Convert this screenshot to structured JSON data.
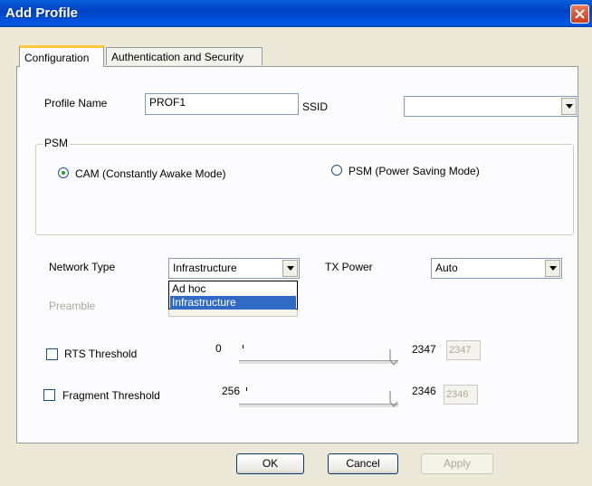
{
  "window": {
    "title": "Add Profile"
  },
  "tabs": [
    {
      "label": "Configuration",
      "active": true
    },
    {
      "label": "Authentication and Security",
      "active": false
    }
  ],
  "profile": {
    "name_label": "Profile Name",
    "name_value": "PROF1",
    "ssid_label": "SSID",
    "ssid_value": ""
  },
  "psm": {
    "group_label": "PSM",
    "cam_label": "CAM (Constantly Awake Mode)",
    "cam_selected": true,
    "psm_label": "PSM (Power Saving Mode)",
    "psm_selected": false
  },
  "network_type": {
    "label": "Network Type",
    "value": "Infrastructure",
    "options": [
      "Ad hoc",
      "Infrastructure"
    ],
    "highlighted": "Infrastructure"
  },
  "tx_power": {
    "label": "TX Power",
    "value": "Auto"
  },
  "preamble": {
    "label": "Preamble"
  },
  "rts": {
    "label": "RTS Threshold",
    "checked": false,
    "min": "0",
    "max": "2347",
    "value": "2347"
  },
  "fragment": {
    "label": "Fragment Threshold",
    "checked": false,
    "min": "256",
    "max": "2346",
    "value": "2346"
  },
  "buttons": {
    "ok": "OK",
    "cancel": "Cancel",
    "apply": "Apply"
  }
}
